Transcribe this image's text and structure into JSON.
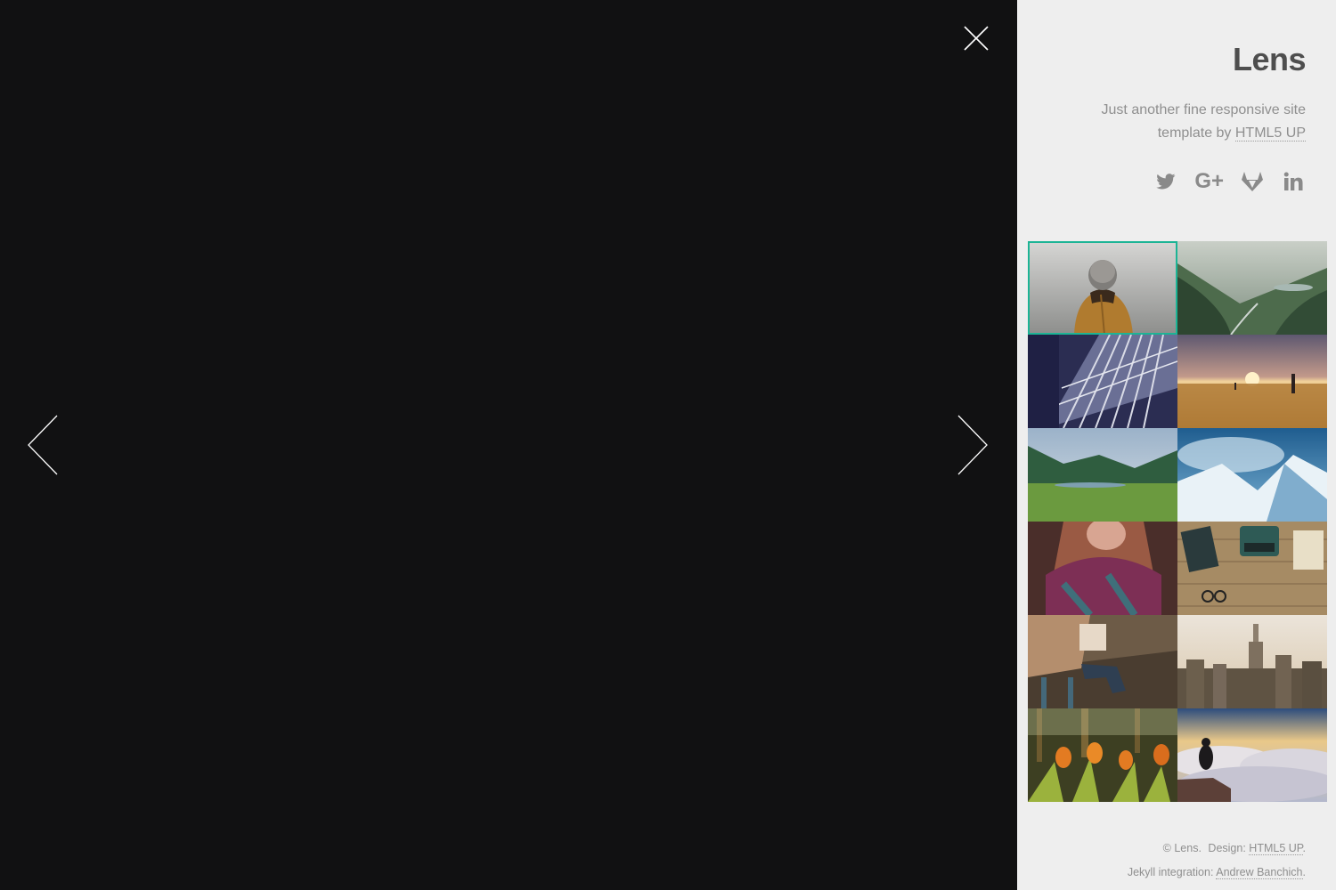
{
  "viewer": {
    "close_icon": "close-icon",
    "prev_icon": "chevron-left-icon",
    "next_icon": "chevron-right-icon"
  },
  "sidebar": {
    "title": "Lens",
    "tagline_prefix": "Just another fine responsive site template by ",
    "tagline_link": "HTML5 UP",
    "socials": [
      {
        "name": "twitter-icon"
      },
      {
        "name": "google-plus-icon",
        "text": "G+"
      },
      {
        "name": "gitlab-icon"
      },
      {
        "name": "linkedin-icon",
        "text": "in"
      }
    ],
    "thumbnails": [
      {
        "name": "thumb-person-hood",
        "active": true
      },
      {
        "name": "thumb-valley"
      },
      {
        "name": "thumb-glass-building"
      },
      {
        "name": "thumb-sunset-field"
      },
      {
        "name": "thumb-green-valley"
      },
      {
        "name": "thumb-snow-mountain"
      },
      {
        "name": "thumb-woman-scarf"
      },
      {
        "name": "thumb-typewriter-desk"
      },
      {
        "name": "thumb-person-sitting"
      },
      {
        "name": "thumb-city-skyline"
      },
      {
        "name": "thumb-tulips"
      },
      {
        "name": "thumb-cloud-sea"
      }
    ],
    "footer": {
      "copyright": "© Lens.",
      "design_prefix": "Design:",
      "design_link": "HTML5 UP",
      "period": ".",
      "jekyll_prefix": "Jekyll integration:",
      "jekyll_link": "Andrew Banchich",
      "period2": "."
    },
    "accent_color": "#1cb495"
  }
}
